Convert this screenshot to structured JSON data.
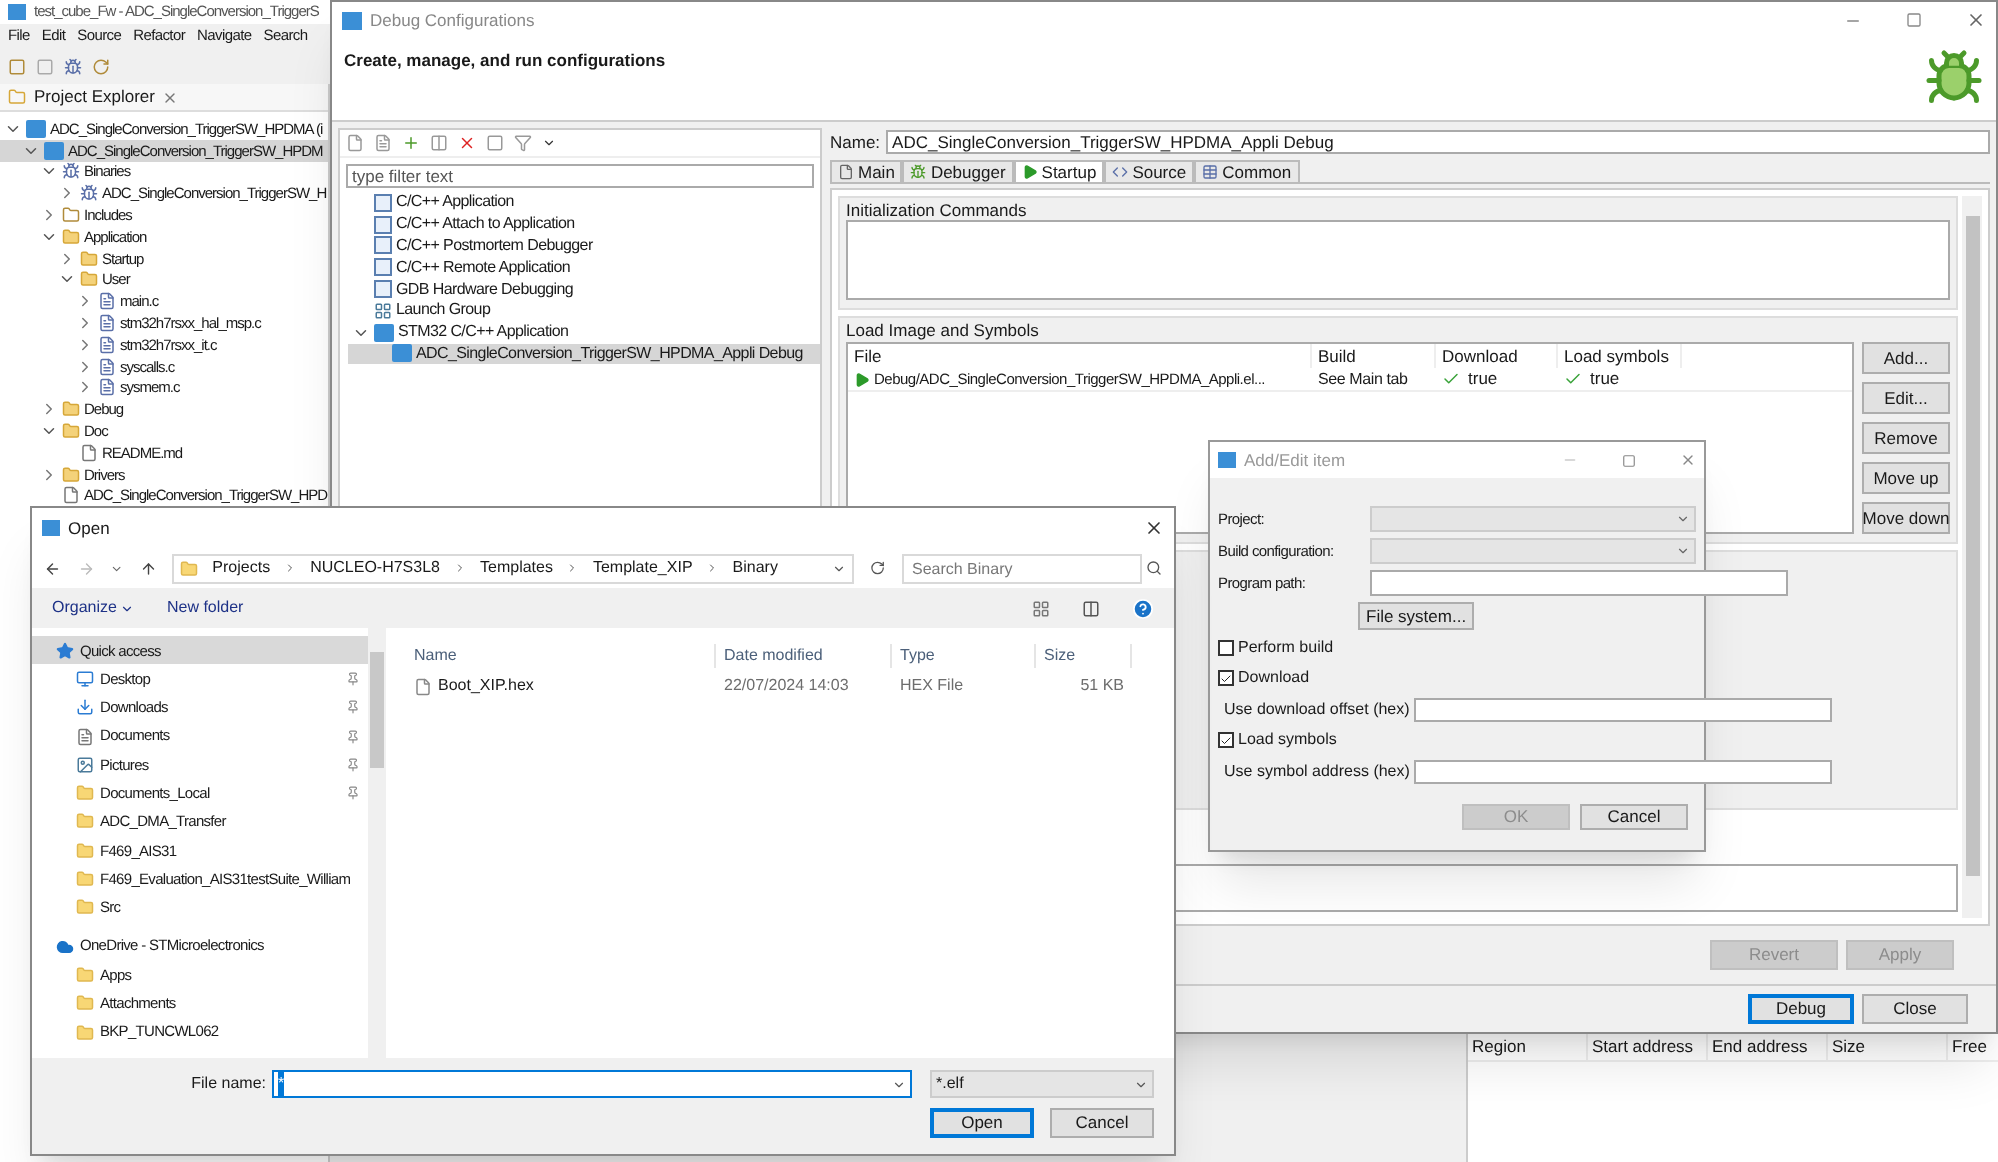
{
  "ide": {
    "title": "test_cube_Fw - ADC_SingleConversion_TriggerS",
    "menu": [
      "File",
      "Edit",
      "Source",
      "Refactor",
      "Navigate",
      "Search"
    ],
    "explorer": {
      "tab": "Project Explorer",
      "tree": [
        {
          "label": "ADC_SingleConversion_TriggerSW_HPDMA (i",
          "kind": "project",
          "expanded": true,
          "selected": false,
          "children": [
            {
              "label": "ADC_SingleConversion_TriggerSW_HPDM",
              "kind": "project",
              "expanded": true,
              "selected": true,
              "children": [
                {
                  "label": "Binaries",
                  "kind": "binaries",
                  "expanded": true,
                  "selected": false,
                  "children": [
                    {
                      "label": "ADC_SingleConversion_TriggerSW_H",
                      "kind": "binary",
                      "expanded": false,
                      "selected": false
                    }
                  ]
                },
                {
                  "label": "Includes",
                  "kind": "includes",
                  "expanded": false,
                  "selected": false
                },
                {
                  "label": "Application",
                  "kind": "folder",
                  "expanded": true,
                  "selected": false,
                  "children": [
                    {
                      "label": "Startup",
                      "kind": "folder",
                      "expanded": false,
                      "selected": false
                    },
                    {
                      "label": "User",
                      "kind": "folder",
                      "expanded": true,
                      "selected": false,
                      "children": [
                        {
                          "label": "main.c",
                          "kind": "c-file",
                          "expanded": false,
                          "selected": false
                        },
                        {
                          "label": "stm32h7rsxx_hal_msp.c",
                          "kind": "c-file",
                          "expanded": false,
                          "selected": false
                        },
                        {
                          "label": "stm32h7rsxx_it.c",
                          "kind": "c-file",
                          "expanded": false,
                          "selected": false
                        },
                        {
                          "label": "syscalls.c",
                          "kind": "c-file",
                          "expanded": false,
                          "selected": false
                        },
                        {
                          "label": "sysmem.c",
                          "kind": "c-file",
                          "expanded": false,
                          "selected": false
                        }
                      ]
                    }
                  ]
                },
                {
                  "label": "Debug",
                  "kind": "folder",
                  "expanded": false,
                  "selected": false
                },
                {
                  "label": "Doc",
                  "kind": "folder",
                  "expanded": true,
                  "selected": false,
                  "children": [
                    {
                      "label": "README.md",
                      "kind": "text-file",
                      "selected": false
                    }
                  ]
                },
                {
                  "label": "Drivers",
                  "kind": "folder",
                  "expanded": false,
                  "selected": false
                },
                {
                  "label": "ADC_SingleConversion_TriggerSW_HPD",
                  "kind": "text-file",
                  "selected": false
                }
              ]
            }
          ]
        }
      ]
    },
    "memory_table": {
      "columns": [
        "Region",
        "Start address",
        "End address",
        "Size",
        "Free"
      ]
    }
  },
  "debug_window": {
    "title": "Debug Configurations",
    "heading": "Create, manage, and run configurations",
    "filter_placeholder": "type filter text",
    "tree": [
      {
        "label": "C/C++ Application",
        "kind": "c",
        "selected": false
      },
      {
        "label": "C/C++ Attach to Application",
        "kind": "c",
        "selected": false
      },
      {
        "label": "C/C++ Postmortem Debugger",
        "kind": "c",
        "selected": false
      },
      {
        "label": "C/C++ Remote Application",
        "kind": "c",
        "selected": false
      },
      {
        "label": "GDB Hardware Debugging",
        "kind": "c",
        "selected": false
      },
      {
        "label": "Launch Group",
        "kind": "group",
        "selected": false
      },
      {
        "label": "STM32 C/C++ Application",
        "kind": "ide",
        "expanded": true,
        "selected": false,
        "children": [
          {
            "label": "ADC_SingleConversion_TriggerSW_HPDMA_Appli Debug",
            "kind": "ide",
            "selected": true
          }
        ]
      }
    ],
    "name_label": "Name:",
    "name_value": "ADC_SingleConversion_TriggerSW_HPDMA_Appli Debug",
    "tabs": [
      {
        "label": "Main",
        "kind": "main",
        "selected": false
      },
      {
        "label": "Debugger",
        "kind": "debugger",
        "selected": false
      },
      {
        "label": "Startup",
        "kind": "startup",
        "selected": true
      },
      {
        "label": "Source",
        "kind": "source",
        "selected": false
      },
      {
        "label": "Common",
        "kind": "common",
        "selected": false
      }
    ],
    "init_label": "Initialization Commands",
    "load_label": "Load Image and Symbols",
    "load_table": {
      "columns": [
        "File",
        "Build",
        "Download",
        "Load symbols"
      ],
      "rows": [
        {
          "file": "Debug/ADC_SingleConversion_TriggerSW_HPDMA_Appli.el...",
          "build": "See Main tab",
          "download": {
            "checked": true,
            "text": "true"
          },
          "symbols": {
            "checked": true,
            "text": "true"
          }
        }
      ]
    },
    "side_buttons": [
      "Add...",
      "Edit...",
      "Remove",
      "Move up",
      "Move down"
    ],
    "revert": {
      "label": "Revert",
      "disabled": true
    },
    "apply": {
      "label": "Apply",
      "disabled": true
    },
    "footer_buttons": [
      {
        "label": "Debug",
        "selected": true
      },
      {
        "label": "Close",
        "selected": false
      }
    ]
  },
  "add_edit_dialog": {
    "title": "Add/Edit item",
    "fields": [
      {
        "label": "Project:",
        "kind": "select"
      },
      {
        "label": "Build configuration:",
        "kind": "select"
      },
      {
        "label": "Program path:",
        "kind": "input"
      }
    ],
    "file_system_button": "File system...",
    "options": [
      {
        "label": "Perform build",
        "kind": "check",
        "checked": false
      },
      {
        "label": "Download",
        "kind": "check",
        "checked": true
      },
      {
        "label": "Use download offset (hex)",
        "kind": "field"
      },
      {
        "label": "Load symbols",
        "kind": "check",
        "checked": true
      },
      {
        "label": "Use symbol address (hex)",
        "kind": "field"
      }
    ],
    "ok": {
      "label": "OK",
      "disabled": true
    },
    "cancel": {
      "label": "Cancel",
      "disabled": false
    }
  },
  "open_dialog": {
    "title": "Open",
    "path": [
      "Projects",
      "NUCLEO-H7S3L8",
      "Templates",
      "Template_XIP",
      "Binary"
    ],
    "search_placeholder": "Search Binary",
    "organize": "Organize",
    "new_folder": "New folder",
    "nav": [
      {
        "label": "Quick access",
        "kind": "quick",
        "pinned": false,
        "selected": true
      },
      {
        "label": "Desktop",
        "kind": "desktop",
        "pinned": true,
        "selected": false
      },
      {
        "label": "Downloads",
        "kind": "downloads",
        "pinned": true,
        "selected": false
      },
      {
        "label": "Documents",
        "kind": "documents",
        "pinned": true,
        "selected": false
      },
      {
        "label": "Pictures",
        "kind": "pictures",
        "pinned": true,
        "selected": false
      },
      {
        "label": "Documents_Local",
        "kind": "folder",
        "pinned": true,
        "selected": false
      },
      {
        "label": "ADC_DMA_Transfer",
        "kind": "folder",
        "pinned": false,
        "selected": false
      },
      {
        "label": "F469_AIS31",
        "kind": "folder",
        "pinned": false,
        "selected": false
      },
      {
        "label": "F469_Evaluation_AIS31testSuite_William",
        "kind": "folder",
        "pinned": false,
        "selected": false
      },
      {
        "label": "Src",
        "kind": "folder",
        "pinned": false,
        "selected": false
      },
      {
        "label": "OneDrive - STMicroelectronics",
        "kind": "onedrive",
        "pinned": false,
        "selected": false
      },
      {
        "label": "Apps",
        "kind": "folder",
        "pinned": false,
        "selected": false
      },
      {
        "label": "Attachments",
        "kind": "folder",
        "pinned": false,
        "selected": false
      },
      {
        "label": "BKP_TUNCWL062",
        "kind": "folder",
        "pinned": false,
        "selected": false
      }
    ],
    "columns": [
      "Name",
      "Date modified",
      "Type",
      "Size"
    ],
    "files": [
      {
        "name": "Boot_XIP.hex",
        "date": "22/07/2024 14:03",
        "type": "HEX File",
        "size": "51 KB"
      }
    ],
    "file_name_label": "File name:",
    "file_name_value": "*",
    "filter": "*.elf",
    "open": "Open",
    "cancel": "Cancel"
  }
}
